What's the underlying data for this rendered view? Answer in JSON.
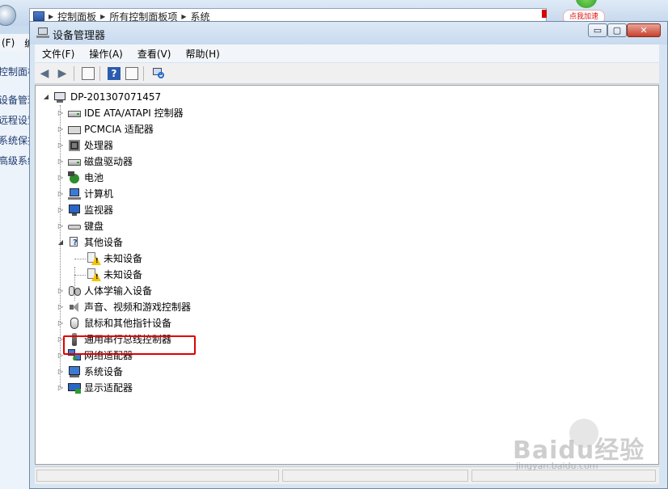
{
  "background_window": {
    "breadcrumb": [
      "控制面板",
      "所有控制面板项",
      "系统"
    ],
    "menu_fragments": [
      "(F)",
      "编"
    ],
    "sidebar_items": [
      "控制面板",
      "设备管理",
      "远程设置",
      "系统保护",
      "高级系统"
    ]
  },
  "baidu_badge": {
    "label": "点我加速"
  },
  "window": {
    "title": "设备管理器",
    "controls": {
      "minimize": "▭",
      "maximize": "▢",
      "close": "✕"
    }
  },
  "menu": [
    "文件(F)",
    "操作(A)",
    "查看(V)",
    "帮助(H)"
  ],
  "tree": {
    "root": "DP-201307071457",
    "items": [
      {
        "label": "IDE ATA/ATAPI 控制器",
        "icon": "drive-controller-icon",
        "expanded": false
      },
      {
        "label": "PCMCIA 适配器",
        "icon": "card-adapter-icon",
        "expanded": false
      },
      {
        "label": "处理器",
        "icon": "processor-icon",
        "expanded": false
      },
      {
        "label": "磁盘驱动器",
        "icon": "disk-drive-icon",
        "expanded": false
      },
      {
        "label": "电池",
        "icon": "battery-icon",
        "expanded": false
      },
      {
        "label": "计算机",
        "icon": "computer-icon",
        "expanded": false
      },
      {
        "label": "监视器",
        "icon": "monitor-icon",
        "expanded": false
      },
      {
        "label": "键盘",
        "icon": "keyboard-icon",
        "expanded": false
      },
      {
        "label": "其他设备",
        "icon": "unknown-device-icon",
        "expanded": true,
        "children": [
          {
            "label": "未知设备",
            "icon": "warning-device-icon"
          },
          {
            "label": "未知设备",
            "icon": "warning-device-icon"
          }
        ]
      },
      {
        "label": "人体学输入设备",
        "icon": "hid-icon",
        "expanded": false
      },
      {
        "label": "声音、视频和游戏控制器",
        "icon": "sound-icon",
        "expanded": false
      },
      {
        "label": "鼠标和其他指针设备",
        "icon": "mouse-icon",
        "expanded": false,
        "highlighted": true
      },
      {
        "label": "通用串行总线控制器",
        "icon": "usb-icon",
        "expanded": false
      },
      {
        "label": "网络适配器",
        "icon": "network-adapter-icon",
        "expanded": false
      },
      {
        "label": "系统设备",
        "icon": "system-device-icon",
        "expanded": false
      },
      {
        "label": "显示适配器",
        "icon": "display-adapter-icon",
        "expanded": false
      }
    ]
  },
  "watermark": {
    "brand": "Baidu经验",
    "url": "jingyan.baidu.com"
  },
  "colors": {
    "highlight": "#e00000",
    "window_frame": "#d7e4f2",
    "tree_bg": "#ffffff"
  }
}
